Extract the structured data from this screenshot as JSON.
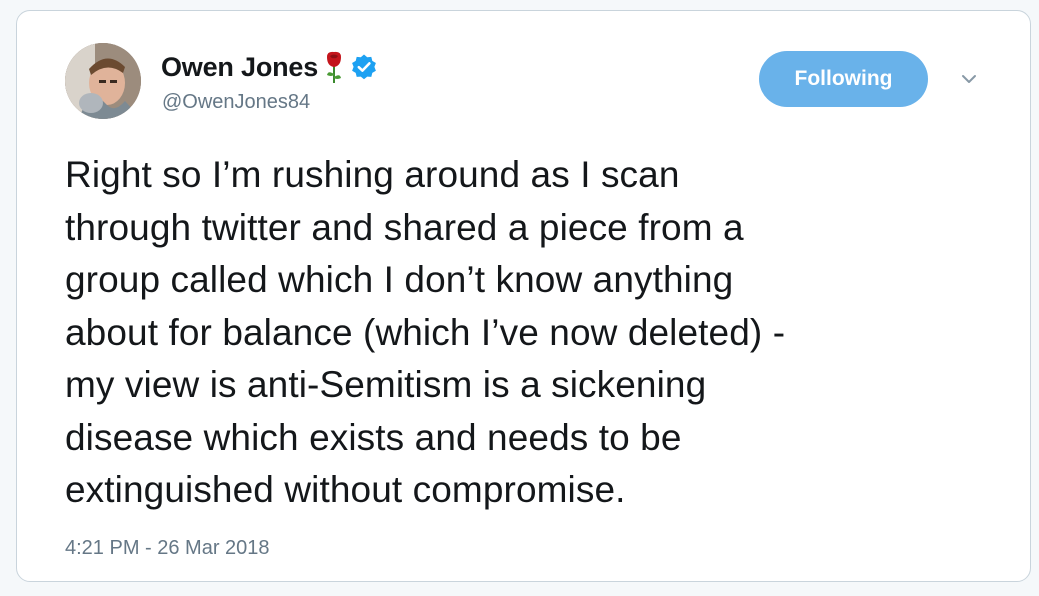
{
  "tweet": {
    "author_name": "Owen Jones",
    "author_handle": "@OwenJones84",
    "follow_label": "Following",
    "text": "Right so I’m rushing around as I scan\nthrough twitter and shared a piece from a\ngroup called which I don’t know anything\nabout for balance (which I’ve now deleted) -\nmy view is anti-Semitism is a sickening\ndisease which exists and needs to be\nextinguished without compromise.",
    "timestamp": "4:21 PM - 26 Mar 2018"
  },
  "icons": {
    "avatar": "profile-photo",
    "name_emoji": "rose-icon",
    "verified": "verified-badge-icon",
    "menu": "chevron-down-icon"
  },
  "colors": {
    "follow_button": "#69b2ea",
    "verified_badge": "#1da1f2",
    "rose": "#c4151c",
    "text_primary": "#14171a",
    "text_secondary": "#657786"
  }
}
